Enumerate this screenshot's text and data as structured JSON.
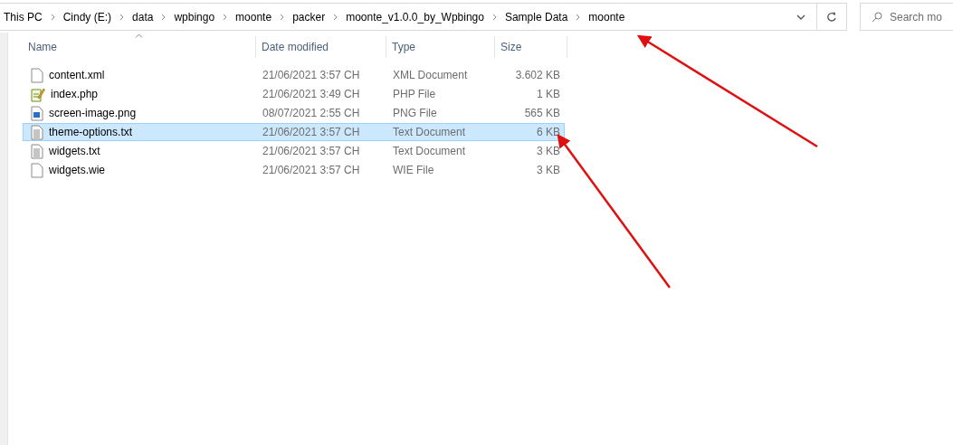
{
  "address_bar": {
    "breadcrumbs": [
      "This PC",
      "Cindy (E:)",
      "data",
      "wpbingo",
      "moonte",
      "packer",
      "moonte_v1.0.0_by_Wpbingo",
      "Sample Data",
      "moonte"
    ]
  },
  "search": {
    "placeholder": "Search mo"
  },
  "table": {
    "columns": [
      "Name",
      "Date modified",
      "Type",
      "Size"
    ],
    "rows": [
      {
        "name": "content.xml",
        "kind": "blank",
        "date": "21/06/2021 3:57 CH",
        "type": "XML Document",
        "size": "3.602 KB",
        "selected": false
      },
      {
        "name": "index.php",
        "kind": "script",
        "date": "21/06/2021 3:49 CH",
        "type": "PHP File",
        "size": "1 KB",
        "selected": false
      },
      {
        "name": "screen-image.png",
        "kind": "image",
        "date": "08/07/2021 2:55 CH",
        "type": "PNG File",
        "size": "565 KB",
        "selected": false
      },
      {
        "name": "theme-options.txt",
        "kind": "text",
        "date": "21/06/2021 3:57 CH",
        "type": "Text Document",
        "size": "6 KB",
        "selected": true
      },
      {
        "name": "widgets.txt",
        "kind": "text",
        "date": "21/06/2021 3:57 CH",
        "type": "Text Document",
        "size": "3 KB",
        "selected": false
      },
      {
        "name": "widgets.wie",
        "kind": "blank",
        "date": "21/06/2021 3:57 CH",
        "type": "WIE File",
        "size": "3 KB",
        "selected": false
      }
    ]
  }
}
